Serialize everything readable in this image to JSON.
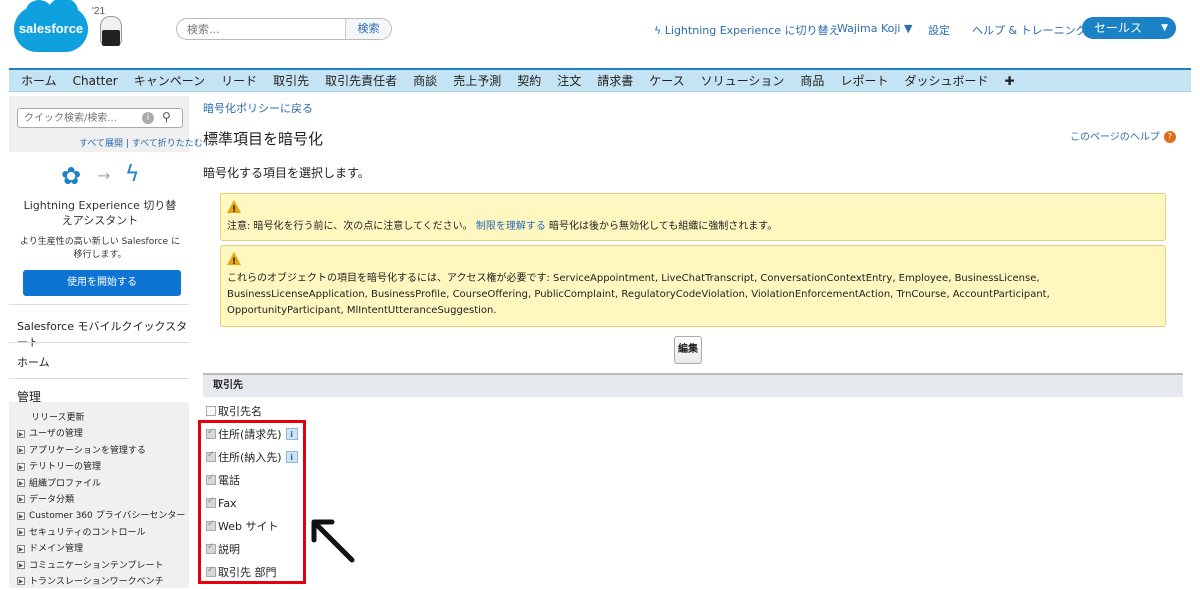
{
  "header": {
    "logo_text": "salesforce",
    "mascot_year": "'21",
    "search_placeholder": "検索...",
    "search_button": "検索",
    "lightning_link": "Lightning Experience に切り替え",
    "user_name": "Wajima Koji ▼",
    "setup_link": "設定",
    "help_link": "ヘルプ & トレーニング",
    "app_switch": "セールス"
  },
  "tabs": [
    "ホーム",
    "Chatter",
    "キャンペーン",
    "リード",
    "取引先",
    "取引先責任者",
    "商談",
    "売上予測",
    "契約",
    "注文",
    "請求書",
    "ケース",
    "ソリューション",
    "商品",
    "レポート",
    "ダッシュボード",
    "✚"
  ],
  "sidebar": {
    "quick_find_placeholder": "クイック検索/検索...",
    "expand_links": "すべて展開 | すべて折りたたむ",
    "le_title": "Lightning Experience 切り替えアシスタント",
    "le_desc": "より生産性の高い新しい Salesforce に移行します。",
    "le_button": "使用を開始する",
    "mobile_section": "Salesforce モバイルクイックスタート",
    "home_section": "ホーム",
    "admin_section": "管理",
    "admin_items": [
      {
        "label": "リリース更新",
        "expandable": false
      },
      {
        "label": "ユーザの管理",
        "expandable": true
      },
      {
        "label": "アプリケーションを管理する",
        "expandable": true
      },
      {
        "label": "テリトリーの管理",
        "expandable": true
      },
      {
        "label": "組織プロファイル",
        "expandable": true
      },
      {
        "label": "データ分類",
        "expandable": true
      },
      {
        "label": "Customer 360 プライバシーセンター",
        "expandable": true
      },
      {
        "label": "セキュリティのコントロール",
        "expandable": true
      },
      {
        "label": "ドメイン管理",
        "expandable": true
      },
      {
        "label": "コミュニケーションテンプレート",
        "expandable": true
      },
      {
        "label": "トランスレーションワークベンチ",
        "expandable": true
      }
    ]
  },
  "main": {
    "back_link": "暗号化ポリシーに戻る",
    "title": "標準項目を暗号化",
    "help_page": "このページのヘルプ",
    "subtitle": "暗号化する項目を選択します。",
    "warning1_prefix": "注意: 暗号化を行う前に、次の点に注意してください。",
    "warning1_link": "制限を理解する",
    "warning1_suffix": "暗号化は後から無効化しても組織に強制されます。",
    "warning2": "これらのオブジェクトの項目を暗号化するには、アクセス権が必要です: ServiceAppointment, LiveChatTranscript, ConversationContextEntry, Employee, BusinessLicense, BusinessLicenseApplication, BusinessProfile, CourseOffering, PublicComplaint, RegulatoryCodeViolation, ViolationEnforcementAction, TrnCourse, AccountParticipant, OpportunityParticipant, MlIntentUtteranceSuggestion.",
    "edit_button": "編集",
    "section_title": "取引先",
    "fields": [
      {
        "label": "取引先名",
        "checked": false,
        "info": false
      },
      {
        "label": "住所(請求先)",
        "checked": true,
        "info": true
      },
      {
        "label": "住所(納入先)",
        "checked": true,
        "info": true
      },
      {
        "label": "電話",
        "checked": true,
        "info": false
      },
      {
        "label": "Fax",
        "checked": true,
        "info": false
      },
      {
        "label": "Web サイト",
        "checked": true,
        "info": false
      },
      {
        "label": "説明",
        "checked": true,
        "info": false
      },
      {
        "label": "取引先 部門",
        "checked": true,
        "info": false
      }
    ]
  },
  "colors": {
    "brand_blue": "#1b82c5",
    "tab_bar": "#c4e3f3",
    "warning_bg": "#fff7c0",
    "annotation_red": "#e3000f"
  }
}
